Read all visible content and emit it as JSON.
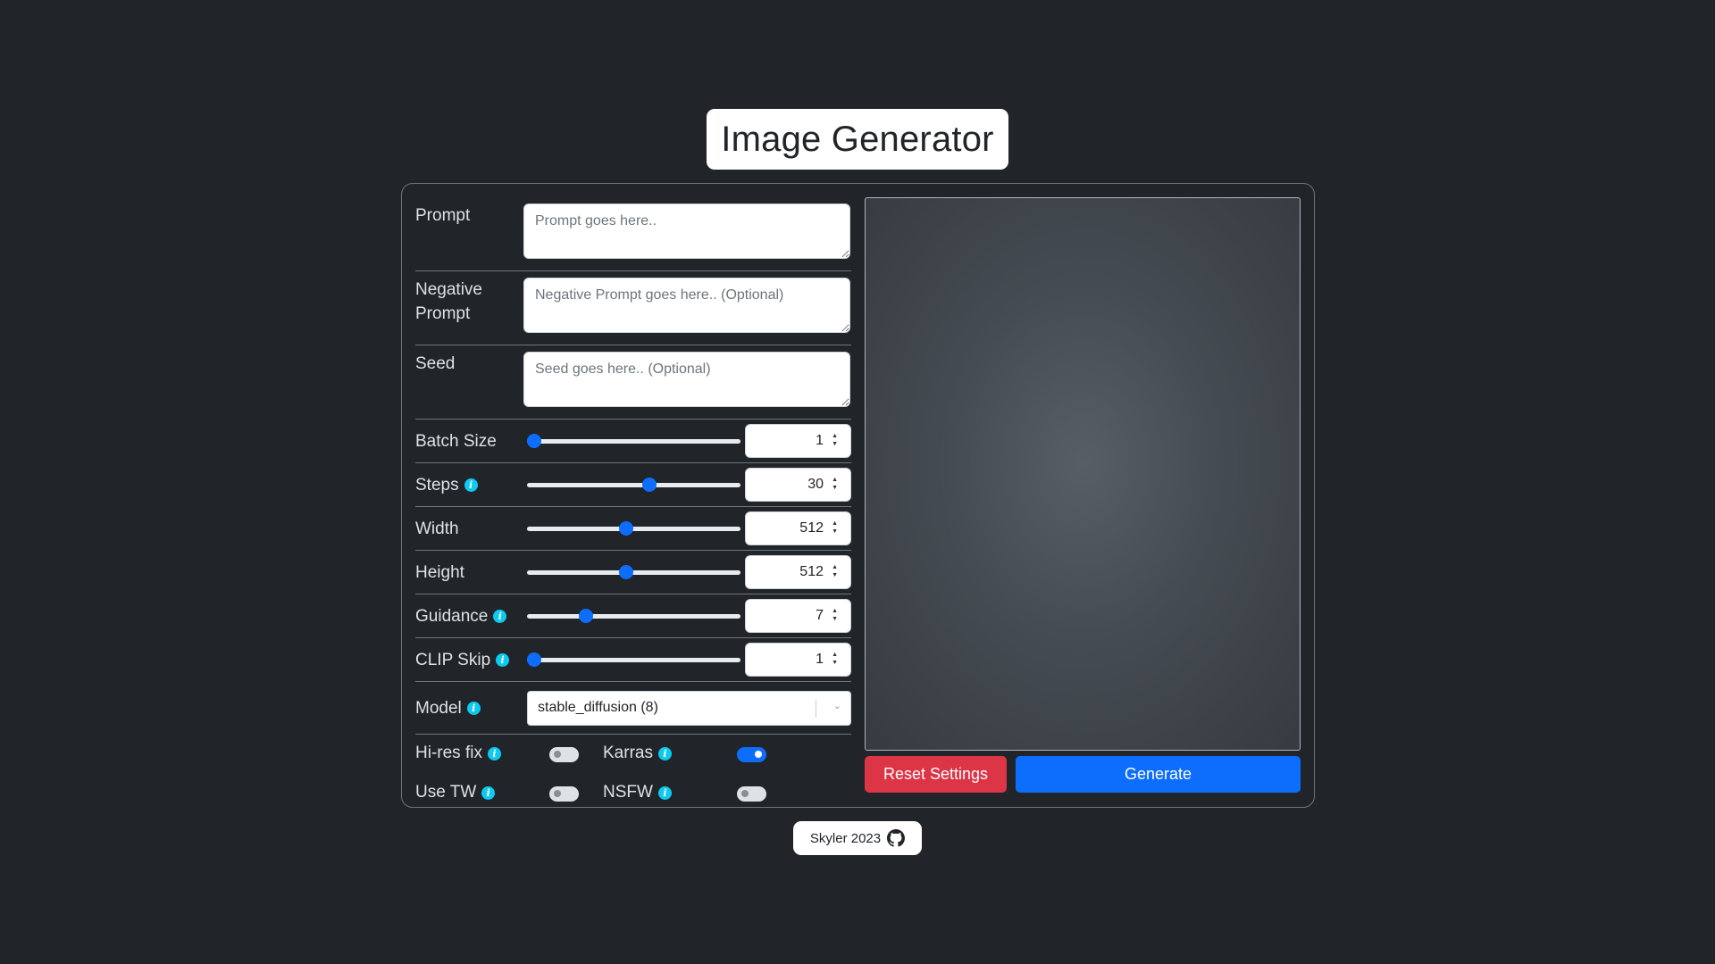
{
  "title": "Image Generator",
  "form": {
    "prompt": {
      "label": "Prompt",
      "placeholder": "Prompt goes here.."
    },
    "negative": {
      "label": "Negative Prompt",
      "placeholder": "Negative Prompt goes here.. (Optional)"
    },
    "seed": {
      "label": "Seed",
      "placeholder": "Seed goes here.. (Optional)"
    },
    "sliders": [
      {
        "label": "Batch Size",
        "value": "1",
        "level": 0.0,
        "info": false
      },
      {
        "label": "Steps",
        "value": "30",
        "level": 0.58,
        "info": true
      },
      {
        "label": "Width",
        "value": "512",
        "level": 0.46,
        "info": false
      },
      {
        "label": "Height",
        "value": "512",
        "level": 0.46,
        "info": false
      },
      {
        "label": "Guidance",
        "value": "7",
        "level": 0.26,
        "info": true
      },
      {
        "label": "CLIP Skip",
        "value": "1",
        "level": 0.0,
        "info": true
      }
    ],
    "model": {
      "label": "Model",
      "value": "stable_diffusion (8)"
    },
    "toggles": [
      {
        "label": "Hi-res fix",
        "on": false
      },
      {
        "label": "Karras",
        "on": true
      },
      {
        "label": "Use TW",
        "on": false
      },
      {
        "label": "NSFW",
        "on": false
      }
    ]
  },
  "buttons": {
    "reset": "Reset Settings",
    "generate": "Generate"
  },
  "footer": {
    "text": "Skyler 2023",
    "icon": "github-icon"
  },
  "colors": {
    "accent": "#0d6efd",
    "danger": "#dc3545",
    "info": "#0dcaf0",
    "background": "#212529"
  }
}
